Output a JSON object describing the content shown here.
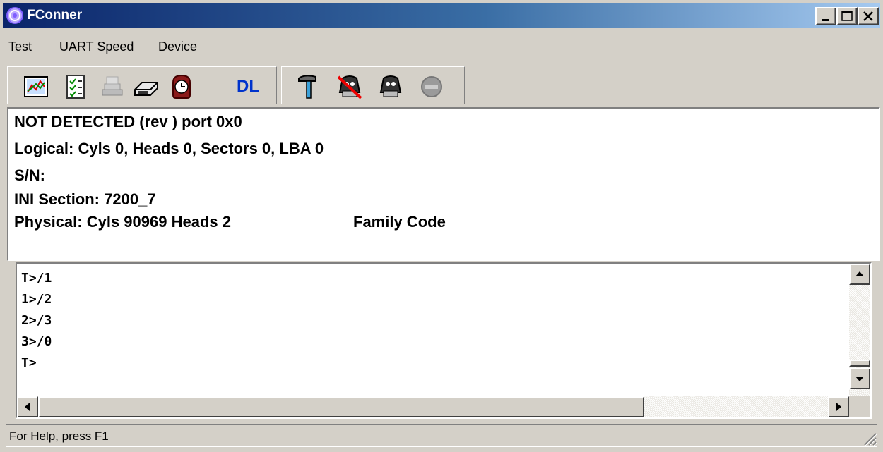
{
  "window": {
    "title": "FConner"
  },
  "menu": [
    "Test",
    "UART Speed",
    "Device"
  ],
  "toolbar": {
    "buttons": [
      {
        "icon": "chart-icon"
      },
      {
        "icon": "checklist-icon"
      },
      {
        "icon": "stack-icon",
        "disabled": true
      },
      {
        "icon": "drive-icon"
      },
      {
        "icon": "clock-icon"
      },
      {
        "icon": "dl-icon",
        "label": "DL"
      },
      {
        "icon": "hammer-icon"
      },
      {
        "icon": "heads-off-icon"
      },
      {
        "icon": "heads-icon"
      },
      {
        "icon": "stop-icon",
        "disabled": true
      }
    ]
  },
  "info": {
    "line1": "NOT DETECTED (rev ) port 0x0",
    "line2": "Logical: Cyls 0, Heads 0, Sectors 0, LBA 0",
    "line3": "S/N:",
    "line4": "INI Section: 7200_7",
    "line5_a": "Physical: Cyls 90969 Heads 2",
    "line5_b": "Family Code"
  },
  "terminal": {
    "lines": [
      "T>/1",
      "1>/2",
      "2>/3",
      "3>/0",
      "T>"
    ]
  },
  "status": {
    "text": "For Help, press F1"
  }
}
